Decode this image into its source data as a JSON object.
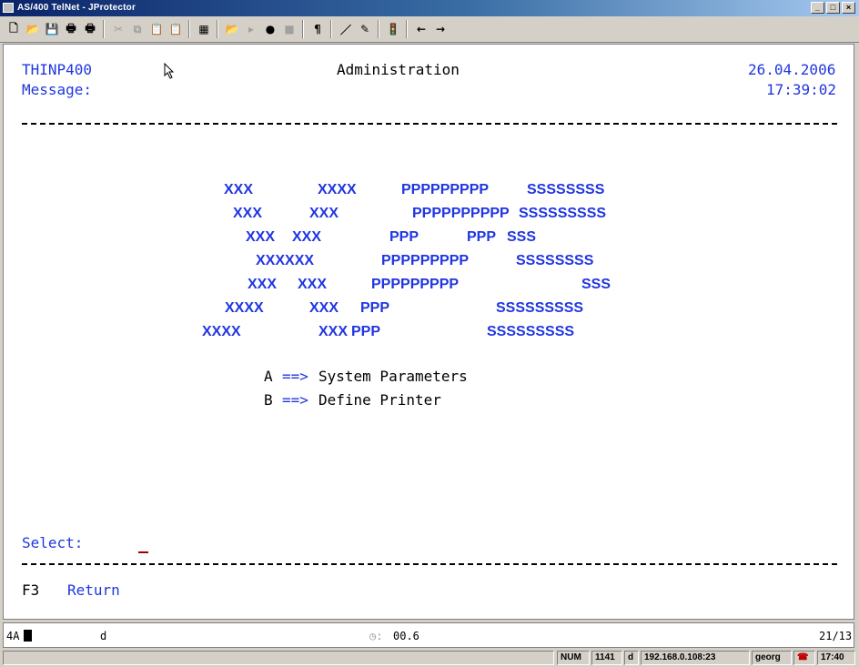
{
  "window": {
    "title": "AS/400 TelNet - JProtector",
    "controls": [
      "_",
      "□",
      "×"
    ]
  },
  "toolbar": {
    "icons": [
      "new-document-icon",
      "open-folder-icon",
      "save-icon",
      "print-icon",
      "print-setup-icon",
      "cut-icon",
      "copy-icon",
      "paste-icon",
      "clipboard-icon",
      "keypad-icon",
      "open-file-icon",
      "play-icon",
      "record-icon",
      "stop-icon",
      "paragraph-icon",
      "pen-icon",
      "edit-icon",
      "traffic-light-icon",
      "arrow-left-icon",
      "arrow-right-icon"
    ],
    "glyphs": [
      "🗋",
      "📂",
      "💾",
      "🖶",
      "🖶",
      "✂",
      "⧉",
      "📋",
      "📋",
      "▦",
      "📂",
      "▸",
      "●",
      "■",
      "¶",
      "／",
      "✎",
      "🚦",
      "←",
      "→"
    ]
  },
  "screen": {
    "program": "THINP400",
    "heading": "Administration",
    "date": "26.04.2006",
    "message_label": "Message:",
    "time": "17:39:02",
    "logo": {
      "x": [
        "XXX",
        "XXXX",
        "XXX",
        "XXX",
        "XXX",
        "XXX",
        "XXXXXX",
        "XXX",
        "XXX",
        "XXXX",
        "XXX",
        "XXXX",
        "XXX"
      ],
      "p": [
        "PPPPPPPPP",
        "PPPPPPPPPP",
        "PPP",
        "PPP",
        "PPPPPPPPP",
        "PPPPPPPPP",
        "PPP",
        "PPP"
      ],
      "s": [
        "SSSSSSSS",
        "SSSSSSSSS",
        "SSS",
        "SSSSSSSS",
        "SSS",
        "SSSSSSSSS",
        "SSSSSSSSS"
      ]
    },
    "menu": [
      {
        "key": "A",
        "arrow": "==>",
        "label": "System Parameters"
      },
      {
        "key": "B",
        "arrow": "==>",
        "label": "Define Printer"
      }
    ],
    "select_label": "Select:",
    "fkey": {
      "key": "F3",
      "label": "Return"
    }
  },
  "status": {
    "mode_indicator": "4A",
    "char": "d",
    "timer": "00.6",
    "position": "21/13"
  },
  "statusbar": {
    "num": "NUM",
    "code": "1141",
    "flag": "d",
    "host": "192.168.0.108:23",
    "user": "georg",
    "clock": "17:40"
  },
  "colors": {
    "field_blue": "#2036e0",
    "background": "#ffffff",
    "cursor": "#a00000"
  }
}
